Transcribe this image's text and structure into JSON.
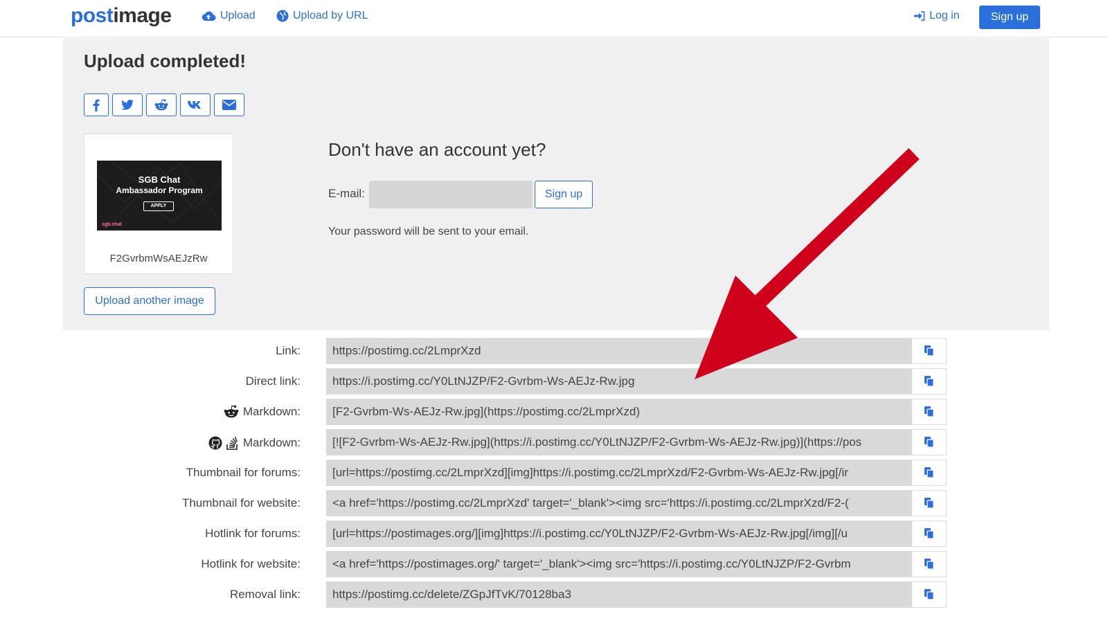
{
  "nav": {
    "logo_part1": "post",
    "logo_part2": "image",
    "upload_label": "Upload",
    "upload_url_label": "Upload by URL",
    "login_label": "Log in",
    "signup_label": "Sign up"
  },
  "panel": {
    "title": "Upload completed!",
    "share_icons": [
      "facebook-icon",
      "twitter-icon",
      "reddit-icon",
      "vk-icon",
      "email-icon"
    ],
    "thumbnail": {
      "line1": "SGB Chat",
      "line2": "Ambassador Program",
      "apply": "APPLY",
      "brand": "sgb.chat",
      "name": "F2GvrbmWsAEJzRw"
    },
    "upload_another_label": "Upload another image",
    "account": {
      "title": "Don't have an account yet?",
      "email_label": "E-mail:",
      "email_value": "",
      "signup_label": "Sign up",
      "password_note": "Your password will be sent to your email."
    }
  },
  "links": [
    {
      "label": "Link:",
      "icons": [],
      "value": "https://postimg.cc/2LmprXzd"
    },
    {
      "label": "Direct link:",
      "icons": [],
      "value": "https://i.postimg.cc/Y0LtNJZP/F2-Gvrbm-Ws-AEJz-Rw.jpg"
    },
    {
      "label": "Markdown:",
      "icons": [
        "reddit-icon"
      ],
      "value": "[F2-Gvrbm-Ws-AEJz-Rw.jpg](https://postimg.cc/2LmprXzd)"
    },
    {
      "label": "Markdown:",
      "icons": [
        "github-icon",
        "stackoverflow-icon"
      ],
      "value": "[![F2-Gvrbm-Ws-AEJz-Rw.jpg](https://i.postimg.cc/Y0LtNJZP/F2-Gvrbm-Ws-AEJz-Rw.jpg)](https://pos"
    },
    {
      "label": "Thumbnail for forums:",
      "icons": [],
      "value": "[url=https://postimg.cc/2LmprXzd][img]https://i.postimg.cc/2LmprXzd/F2-Gvrbm-Ws-AEJz-Rw.jpg[/ir"
    },
    {
      "label": "Thumbnail for website:",
      "icons": [],
      "value": "<a href='https://postimg.cc/2LmprXzd' target='_blank'><img src='https://i.postimg.cc/2LmprXzd/F2-("
    },
    {
      "label": "Hotlink for forums:",
      "icons": [],
      "value": "[url=https://postimages.org/][img]https://i.postimg.cc/Y0LtNJZP/F2-Gvrbm-Ws-AEJz-Rw.jpg[/img][/u"
    },
    {
      "label": "Hotlink for website:",
      "icons": [],
      "value": "<a href='https://postimages.org/' target='_blank'><img src='https://i.postimg.cc/Y0LtNJZP/F2-Gvrbm"
    },
    {
      "label": "Removal link:",
      "icons": [],
      "value": "https://postimg.cc/delete/ZGpJfTvK/70128ba3"
    }
  ],
  "colors": {
    "accent": "#2a6fdb",
    "panel_bg": "#f0f0f0",
    "field_bg": "#d9d9d9",
    "arrow": "#d0021b"
  }
}
